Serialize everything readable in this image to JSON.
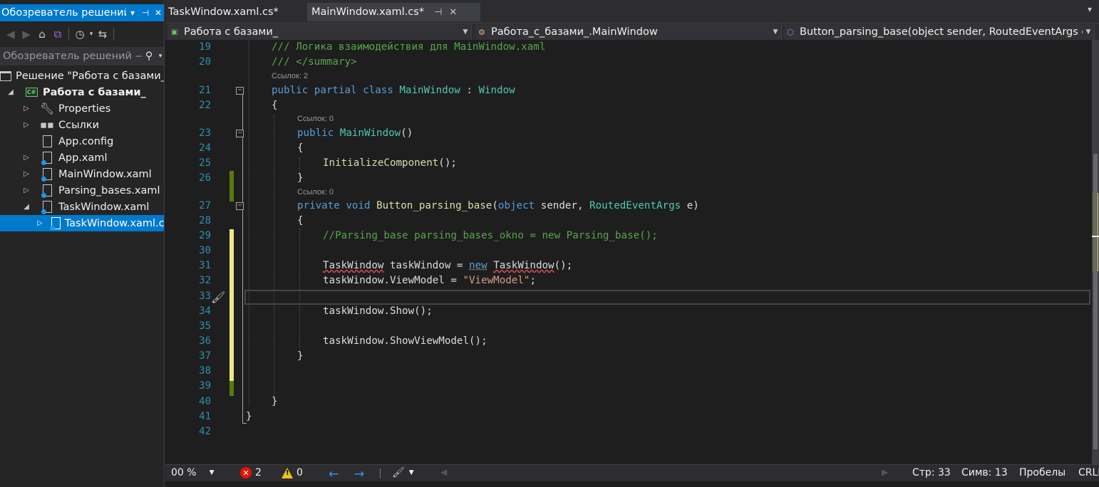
{
  "solution_explorer": {
    "title": "Обозреватель решений",
    "title_controls": {
      "dropdown": "▾",
      "pin": "⊣",
      "close": "✕"
    },
    "search_placeholder": "Обозреватель решений — ",
    "tree": [
      {
        "label": "Решение \"Работа с базами_",
        "indent": 0,
        "expander": "",
        "icon": "solution-icon"
      },
      {
        "label": "Работа с базами_",
        "indent": 1,
        "expander": "◢",
        "icon": "csharp-project-icon",
        "bold": true
      },
      {
        "label": "Properties",
        "indent": 2,
        "expander": "▷",
        "icon": "wrench-icon"
      },
      {
        "label": "Ссылки",
        "indent": 2,
        "expander": "▷",
        "icon": "references-icon"
      },
      {
        "label": "App.config",
        "indent": 2,
        "expander": "",
        "icon": "config-file-icon"
      },
      {
        "label": "App.xaml",
        "indent": 2,
        "expander": "▷",
        "icon": "xaml-file-icon"
      },
      {
        "label": "MainWindow.xaml",
        "indent": 2,
        "expander": "▷",
        "icon": "xaml-file-icon"
      },
      {
        "label": "Parsing_bases.xaml",
        "indent": 2,
        "expander": "▷",
        "icon": "xaml-file-icon"
      },
      {
        "label": "TaskWindow.xaml",
        "indent": 2,
        "expander": "◢",
        "icon": "xaml-file-icon"
      },
      {
        "label": "TaskWindow.xaml.cs",
        "indent": 3,
        "expander": "▷",
        "icon": "cs-file-icon",
        "selected": true
      }
    ]
  },
  "tabs": [
    {
      "label": "TaskWindow.xaml.cs*",
      "active": false
    },
    {
      "label": "MainWindow.xaml.cs*",
      "active": true,
      "pin": "⊣",
      "close": "✕"
    }
  ],
  "tabs_overflow": "▾",
  "navbar": {
    "project": "Работа с базами_",
    "class": "Работа_с_базами_.MainWindow",
    "member": "Button_parsing_base(object sender, RoutedEventArgs e)"
  },
  "code_lens": {
    "refs2": "Ссылок: 2",
    "refs0": "Ссылок: 0"
  },
  "code_lines": [
    {
      "n": "19",
      "tokens": [
        [
          "cm",
          "/// Логика взаимодействия для MainWindow.xaml"
        ]
      ]
    },
    {
      "n": "20",
      "tokens": [
        [
          "cm",
          "/// &lt;/summary&gt;"
        ]
      ]
    },
    {
      "n": "21",
      "tokens": [
        [
          "kw",
          "public "
        ],
        [
          "kw",
          "partial "
        ],
        [
          "kw",
          "class "
        ],
        [
          "ty",
          "MainWindow"
        ],
        [
          "pl",
          " : "
        ],
        [
          "ty",
          "Window"
        ]
      ]
    },
    {
      "n": "22",
      "tokens": [
        [
          "pl",
          "{"
        ]
      ]
    },
    {
      "n": "23",
      "tokens": [
        [
          "kw",
          "public "
        ],
        [
          "ty",
          "MainWindow"
        ],
        [
          "pl",
          "()"
        ]
      ]
    },
    {
      "n": "24",
      "tokens": [
        [
          "pl",
          "{"
        ]
      ]
    },
    {
      "n": "25",
      "tokens": [
        [
          "mt",
          "InitializeComponent"
        ],
        [
          "pl",
          "();"
        ]
      ]
    },
    {
      "n": "26",
      "tokens": [
        [
          "pl",
          "}"
        ]
      ]
    },
    {
      "n": "27",
      "tokens": [
        [
          "kw",
          "private "
        ],
        [
          "kw",
          "void "
        ],
        [
          "mt",
          "Button_parsing_base"
        ],
        [
          "pl",
          "("
        ],
        [
          "kw",
          "object "
        ],
        [
          "pl",
          "sender, "
        ],
        [
          "ty",
          "RoutedEventArgs "
        ],
        [
          "pl",
          "e)"
        ]
      ]
    },
    {
      "n": "28",
      "tokens": [
        [
          "pl",
          "{"
        ]
      ]
    },
    {
      "n": "29",
      "tokens": [
        [
          "cm",
          "//Parsing_base parsing_bases_okno = new Parsing_base();"
        ]
      ]
    },
    {
      "n": "30",
      "tokens": []
    },
    {
      "n": "31",
      "tokens": [
        [
          "pl sq",
          "TaskWindow"
        ],
        [
          "pl",
          " taskWindow = "
        ],
        [
          "kw dots",
          "new"
        ],
        [
          "pl",
          " "
        ],
        [
          "pl sq",
          "TaskWindow"
        ],
        [
          "pl",
          "();"
        ]
      ]
    },
    {
      "n": "32",
      "tokens": [
        [
          "pl",
          "taskWindow.ViewModel = "
        ],
        [
          "st",
          "\"ViewModel\""
        ],
        [
          "pl",
          ";"
        ]
      ]
    },
    {
      "n": "33",
      "tokens": []
    },
    {
      "n": "34",
      "tokens": [
        [
          "pl",
          "taskWindow.Show();"
        ]
      ]
    },
    {
      "n": "35",
      "tokens": []
    },
    {
      "n": "36",
      "tokens": [
        [
          "pl",
          "taskWindow.ShowViewModel();"
        ]
      ]
    },
    {
      "n": "37",
      "tokens": [
        [
          "pl",
          "}"
        ]
      ]
    },
    {
      "n": "38",
      "tokens": []
    },
    {
      "n": "39",
      "tokens": []
    },
    {
      "n": "40",
      "tokens": [
        [
          "pl",
          "}"
        ]
      ]
    },
    {
      "n": "41",
      "tokens": [
        [
          "pl",
          "}"
        ]
      ]
    },
    {
      "n": "42",
      "tokens": []
    }
  ],
  "status_bar": {
    "zoom": "00 %",
    "errors": "2",
    "warnings": "0",
    "line": "Стр: 33",
    "column": "Симв: 13",
    "whitespace": "Пробелы",
    "line_ending": "CRLF"
  },
  "colors": {
    "accent": "#007acc",
    "saved_change": "#587c0c",
    "unsaved_change": "#efe68a"
  }
}
